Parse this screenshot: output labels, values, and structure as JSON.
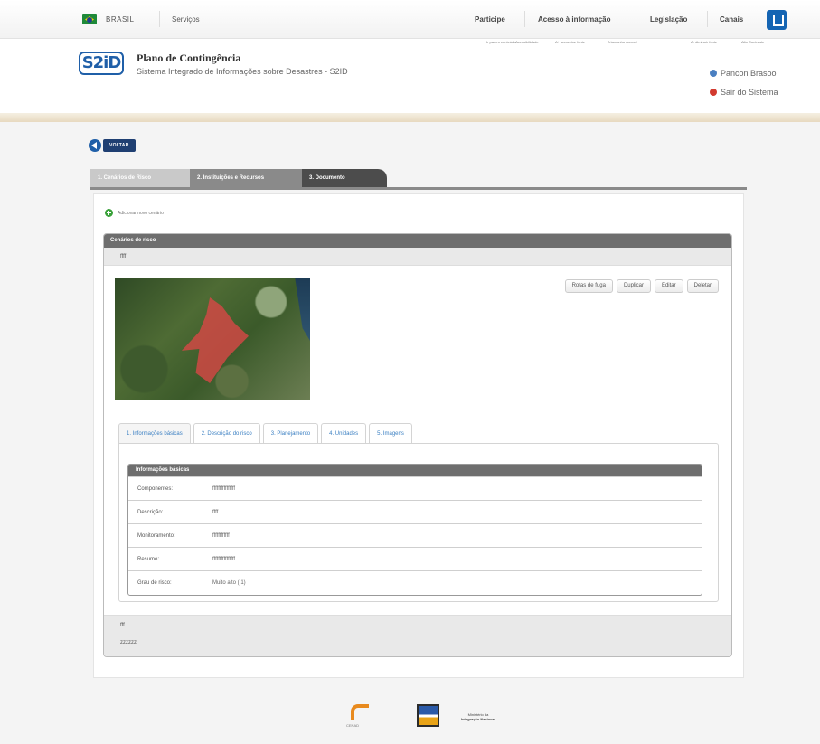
{
  "gov_bar": {
    "country": "BRASIL",
    "servicos": "Serviços",
    "links": [
      "Participe",
      "Acesso à informação",
      "Legislação",
      "Canais"
    ],
    "accessibility": [
      "Ir para o conteúdo",
      "Acessibilidade",
      "A+ aumentar fonte",
      "A tamanho normal",
      "A- diminuir fonte",
      "Alto Contraste"
    ]
  },
  "header": {
    "logo": "S2iD",
    "title": "Plano de Contingência",
    "subtitle": "Sistema Integrado de Informações sobre Desastres - S2ID",
    "user_link": "Pancon Brasoo",
    "exit_link": "Sair do Sistema"
  },
  "nav": {
    "back_label": "VOLTAR",
    "steps": [
      "1. Cenários de Risco",
      "2. Instituições e Recursos",
      "3. Documento"
    ]
  },
  "content": {
    "add_label": "Adicionar novo cenário",
    "panel_title": "Cenários de risco",
    "scenario_name": "ffff",
    "actions": [
      "Rotas de fuga",
      "Duplicar",
      "Editar",
      "Deletar"
    ],
    "tabs": [
      "1. Informações básicas",
      "2. Descrição do risco",
      "3. Planejamento",
      "4. Unidades",
      "5. Imagens"
    ],
    "info_title": "Informações básicas",
    "info_rows": [
      {
        "label": "Componentes:",
        "value": "ffffffffffffffff"
      },
      {
        "label": "Descrição:",
        "value": "ffff"
      },
      {
        "label": "Monitoramento:",
        "value": "ffffffffffff"
      },
      {
        "label": "Resumo:",
        "value": "ffffffffffffffff"
      },
      {
        "label": "Grau de risco:",
        "value": "Muito alto ( 1)"
      }
    ],
    "footer_lines": [
      "fff",
      "zzzzzz"
    ]
  },
  "footer": {
    "cenad": "CENAD",
    "ministry_line1": "Ministério da",
    "ministry_line2": "Integração Nacional"
  }
}
